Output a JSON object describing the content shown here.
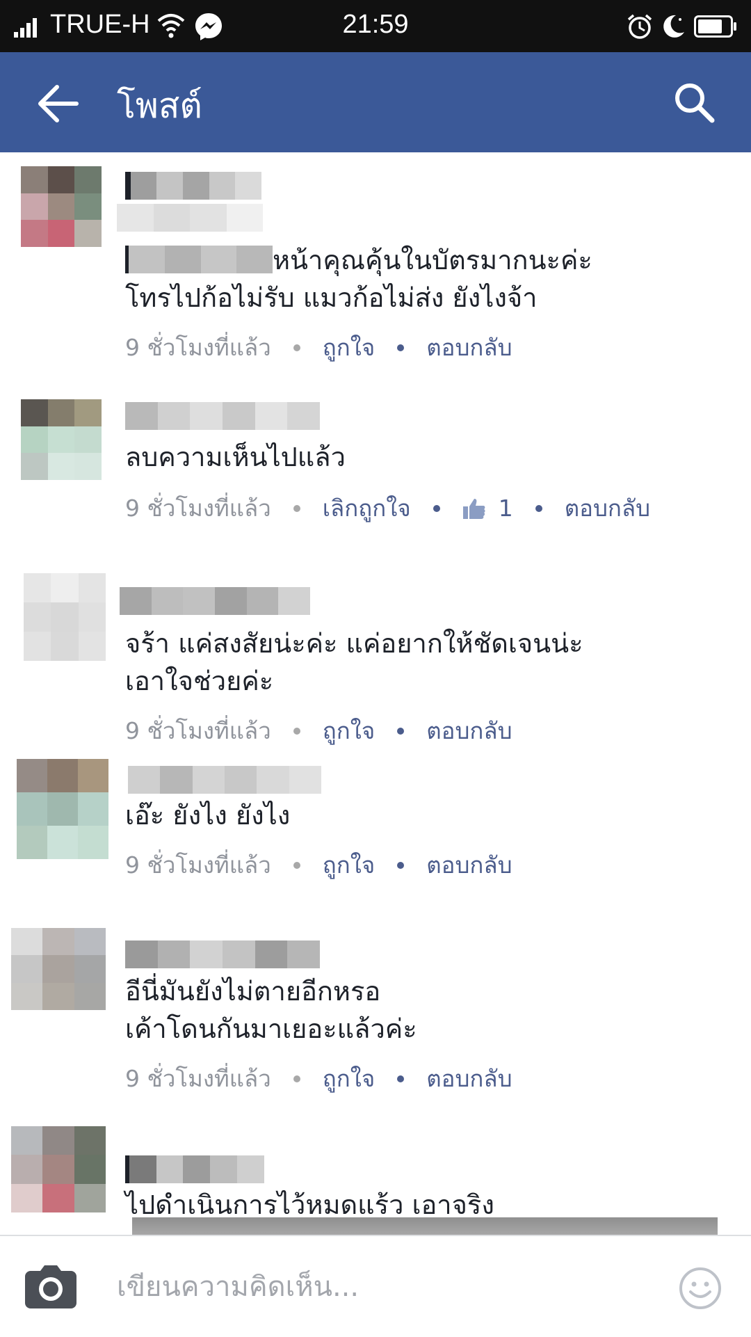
{
  "status_bar": {
    "carrier": "TRUE-H",
    "time": "21:59",
    "icons": [
      "signal-icon",
      "wifi-icon",
      "messenger-icon",
      "alarm-icon",
      "do-not-disturb-icon",
      "battery-icon"
    ]
  },
  "header": {
    "title": "โพสต์",
    "back_icon": "arrow-left-icon",
    "search_icon": "search-icon",
    "bg_color": "#3b5998"
  },
  "comments": [
    {
      "lines": [
        "หน้าคุณคุ้นในบัตรมากนะค่ะ",
        "โทรไปก้อไม่รับ แมวก้อไม่ส่ง ยังไงจ้า"
      ],
      "time": "9 ชั่วโมงที่แล้ว",
      "like": "ถูกใจ",
      "reply": "ตอบกลับ"
    },
    {
      "lines": [
        "ลบความเห็นไปแล้ว"
      ],
      "time": "9 ชั่วโมงที่แล้ว",
      "like": "เลิกถูกใจ",
      "like_count": "1",
      "reply": "ตอบกลับ"
    },
    {
      "lines": [
        "จร้า แค่สงสัยน่ะค่ะ  แค่อยากให้ชัดเจนน่ะ",
        "เอาใจช่วยค่ะ"
      ],
      "time": "9 ชั่วโมงที่แล้ว",
      "like": "ถูกใจ",
      "reply": "ตอบกลับ"
    },
    {
      "lines": [
        "เอ๊ะ ยังไง ยังไง"
      ],
      "time": "9 ชั่วโมงที่แล้ว",
      "like": "ถูกใจ",
      "reply": "ตอบกลับ"
    },
    {
      "lines": [
        "อีนี่มันยังไม่ตายอีกหรอ",
        "เค้าโดนกันมาเยอะแล้วค่ะ"
      ],
      "time": "9 ชั่วโมงที่แล้ว",
      "like": "ถูกใจ",
      "reply": "ตอบกลับ"
    },
    {
      "lines": [
        "ไปดำเนินการไว้หมดแร้ว เอาจริง"
      ]
    }
  ],
  "composer": {
    "placeholder": "เขียนความคิดเห็น...",
    "camera_icon": "camera-icon",
    "emoji_icon": "emoji-icon"
  },
  "colors": {
    "link": "#4b5c8c",
    "meta_text": "#90949c",
    "status_bar_bg": "#111111"
  }
}
